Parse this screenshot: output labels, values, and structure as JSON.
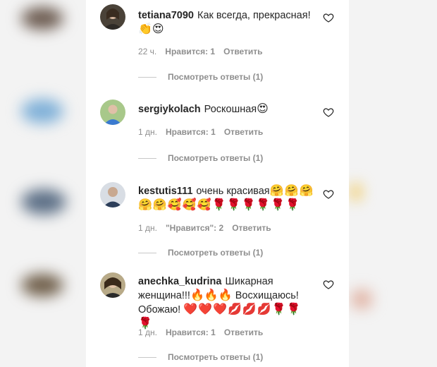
{
  "comments": [
    {
      "username": "tetiana7090",
      "text": "Как всегда, прекрасная!",
      "emoji": "👏😍",
      "time": "22 ч.",
      "likes": "Нравится: 1",
      "reply": "Ответить",
      "view_replies": "Посмотреть ответы (1)"
    },
    {
      "username": "sergiykolach",
      "text": "Роскошная",
      "emoji": "😍",
      "time": "1 дн.",
      "likes": "Нравится: 1",
      "reply": "Ответить",
      "view_replies": "Посмотреть ответы (1)"
    },
    {
      "username": "kestutis111",
      "text": "очень красивая",
      "emoji": "🤗🤗🤗🤗🤗🥰🥰🥰🌹🌹🌹🌹🌹🌹",
      "time": "1 дн.",
      "likes": "\"Нравится\": 2",
      "reply": "Ответить",
      "view_replies": "Посмотреть ответы (1)"
    },
    {
      "username": "anechka_kudrina",
      "text": "Шикарная женщина!!!",
      "emoji": "🔥🔥🔥",
      "text2": "Восхищаюсь! Обожаю!",
      "emoji2": "❤️❤️❤️💋💋💋🌹🌹🌹",
      "time": "1 дн.",
      "likes": "Нравится: 1",
      "reply": "Ответить",
      "view_replies": "Посмотреть ответы (1)"
    }
  ],
  "icons": {
    "like": "heart-outline-icon",
    "avatar": "avatar"
  },
  "colors": {
    "text": "#262626",
    "meta": "#8e8e8e",
    "panel": "#ffffff"
  }
}
